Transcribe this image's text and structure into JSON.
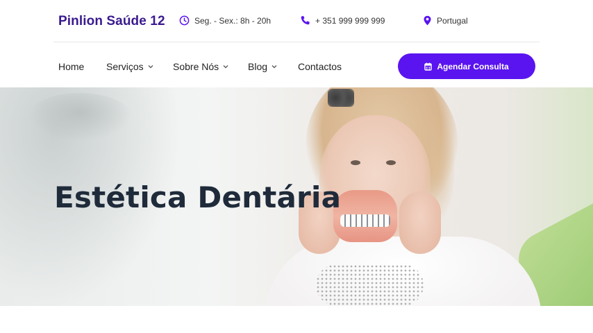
{
  "header": {
    "logo": "Pinlion Saúde 12",
    "hours": "Seg. - Sex.: 8h - 20h",
    "phone": "+ 351 999 999 999",
    "location": "Portugal",
    "icons": {
      "hours": "clock-icon",
      "phone": "phone-icon",
      "location": "map-pin-icon"
    }
  },
  "nav": {
    "items": [
      {
        "label": "Home",
        "has_dropdown": false
      },
      {
        "label": "Serviços",
        "has_dropdown": true
      },
      {
        "label": "Sobre Nós",
        "has_dropdown": true
      },
      {
        "label": "Blog",
        "has_dropdown": true
      },
      {
        "label": "Contactos",
        "has_dropdown": false
      }
    ],
    "chevron": "⌄",
    "cta_label": "Agendar Consulta",
    "cta_icon": "calendar-icon"
  },
  "hero": {
    "title": "Estética Dentária"
  },
  "colors": {
    "brand": "#3a1a8f",
    "accent": "#5a14f0",
    "title": "#1f2b3a"
  }
}
